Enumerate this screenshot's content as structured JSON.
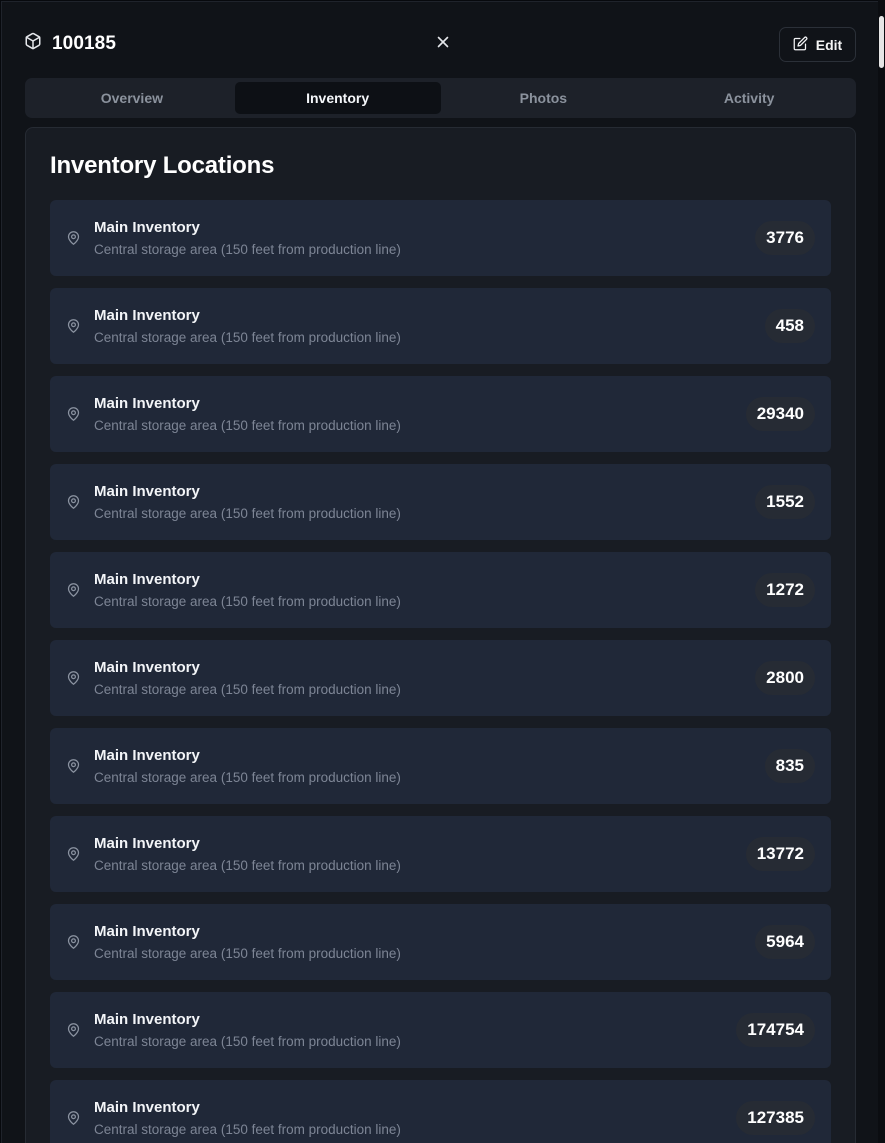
{
  "header": {
    "title": "100185",
    "edit_label": "Edit"
  },
  "tabs": [
    {
      "label": "Overview",
      "active": false
    },
    {
      "label": "Inventory",
      "active": true
    },
    {
      "label": "Photos",
      "active": false
    },
    {
      "label": "Activity",
      "active": false
    }
  ],
  "section": {
    "title": "Inventory Locations"
  },
  "locations": [
    {
      "name": "Main Inventory",
      "description": "Central storage area (150 feet from production line)",
      "quantity": "3776"
    },
    {
      "name": "Main Inventory",
      "description": "Central storage area (150 feet from production line)",
      "quantity": "458"
    },
    {
      "name": "Main Inventory",
      "description": "Central storage area (150 feet from production line)",
      "quantity": "29340"
    },
    {
      "name": "Main Inventory",
      "description": "Central storage area (150 feet from production line)",
      "quantity": "1552"
    },
    {
      "name": "Main Inventory",
      "description": "Central storage area (150 feet from production line)",
      "quantity": "1272"
    },
    {
      "name": "Main Inventory",
      "description": "Central storage area (150 feet from production line)",
      "quantity": "2800"
    },
    {
      "name": "Main Inventory",
      "description": "Central storage area (150 feet from production line)",
      "quantity": "835"
    },
    {
      "name": "Main Inventory",
      "description": "Central storage area (150 feet from production line)",
      "quantity": "13772"
    },
    {
      "name": "Main Inventory",
      "description": "Central storage area (150 feet from production line)",
      "quantity": "5964"
    },
    {
      "name": "Main Inventory",
      "description": "Central storage area (150 feet from production line)",
      "quantity": "174754"
    },
    {
      "name": "Main Inventory",
      "description": "Central storage area (150 feet from production line)",
      "quantity": "127385"
    }
  ],
  "icons": {
    "title": "package-icon",
    "close": "close-icon",
    "edit": "edit-icon",
    "location": "map-pin-icon"
  },
  "colors": {
    "panel_bg": "#101318",
    "card_bg": "#181c23",
    "row_bg": "#202838",
    "badge_bg": "#262b34",
    "muted_text": "#7d8595"
  }
}
